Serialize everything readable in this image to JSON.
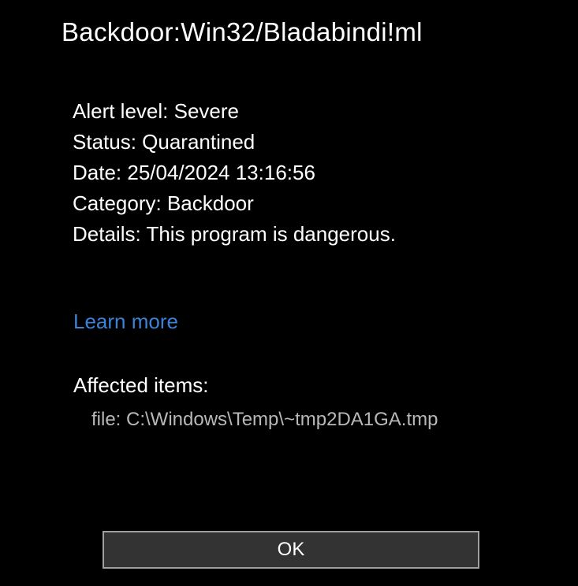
{
  "threat": {
    "name": "Backdoor:Win32/Bladabindi!ml"
  },
  "details": {
    "alertLevel": "Alert level: Severe",
    "status": "Status: Quarantined",
    "date": "Date: 25/04/2024 13:16:56",
    "category": "Category: Backdoor",
    "description": "Details: This program is dangerous."
  },
  "links": {
    "learnMore": "Learn more"
  },
  "affected": {
    "label": "Affected items:",
    "file": "file: C:\\Windows\\Temp\\~tmp2DA1GA.tmp"
  },
  "buttons": {
    "ok": "OK"
  }
}
